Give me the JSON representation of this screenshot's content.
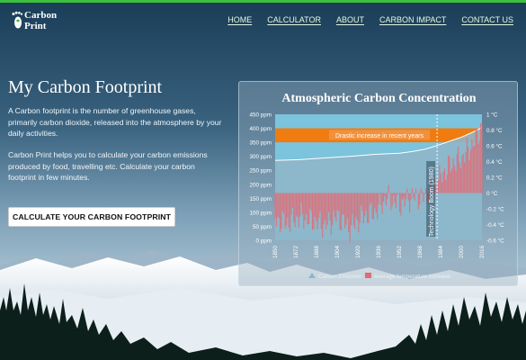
{
  "brand": {
    "line1": "Carbon",
    "line2": "Print",
    "icon": "footprint-icon"
  },
  "nav": {
    "items": [
      "HOME",
      "CALCULATOR",
      "ABOUT",
      "CARBON IMPACT",
      "CONTACT US"
    ],
    "color": "#e6f7e0"
  },
  "hero": {
    "title": "My Carbon Footprint",
    "paragraph1": "A Carbon footprint is the number of greenhouse gases, primarily carbon dioxide, released into the atmosphere by your daily activities.",
    "paragraph2": "Carbon Print helps you to calculate your carbon emissions produced by food, travelling etc. Calculate your carbon footprint in few minutes.",
    "cta_label": "CALCULATE YOUR CARBON FOOTPRINT"
  },
  "chart_data": {
    "type": "area",
    "title": "Atmospheric Carbon Concentration",
    "left_axis": {
      "ticks": [
        "450 ppm",
        "400 ppm",
        "350 ppm",
        "300 ppm",
        "250 ppm",
        "200 ppm",
        "150 ppm",
        "100 ppm",
        "50 ppm",
        "0 ppm"
      ],
      "ylim": [
        0,
        450
      ]
    },
    "right_axis": {
      "ticks": [
        "1 °C",
        "0.8 °C",
        "0.6 °C",
        "0.4 °C",
        "0.2 °C",
        "0 °C",
        "-0.2 °C",
        "-0.4 °C",
        "-0.6 °C"
      ],
      "ylim": [
        -0.6,
        1.0
      ]
    },
    "x_ticks": [
      "1850",
      "1872",
      "1888",
      "1904",
      "1920",
      "1936",
      "1952",
      "1968",
      "1984",
      "2000",
      "2016"
    ],
    "xlim": [
      1850,
      2016
    ],
    "series": [
      {
        "name": "Carbon Emission",
        "color": "#8fb6c9",
        "years": [
          1850,
          1870,
          1890,
          1910,
          1930,
          1950,
          1960,
          1970,
          1980,
          1990,
          2000,
          2010,
          2016
        ],
        "values": [
          285,
          288,
          294,
          300,
          307,
          311,
          317,
          325,
          338,
          354,
          369,
          389,
          403
        ]
      },
      {
        "name": "Average temperature increase",
        "color": "#e36a72",
        "years": [
          1850,
          1860,
          1870,
          1880,
          1890,
          1900,
          1910,
          1920,
          1930,
          1940,
          1950,
          1960,
          1970,
          1980,
          1990,
          2000,
          2010,
          2016
        ],
        "values": [
          -0.35,
          -0.38,
          -0.3,
          -0.35,
          -0.42,
          -0.3,
          -0.45,
          -0.3,
          -0.25,
          -0.05,
          -0.15,
          -0.05,
          -0.05,
          0.15,
          0.35,
          0.45,
          0.65,
          0.85
        ]
      }
    ],
    "annotations": [
      {
        "label": "Drastic increase in recent years",
        "band_ppm": [
          350,
          400
        ],
        "band_color": "#f07b10"
      },
      {
        "label": "Technology Boom (1980)",
        "x": 1980
      }
    ],
    "legend_position": "bottom"
  }
}
